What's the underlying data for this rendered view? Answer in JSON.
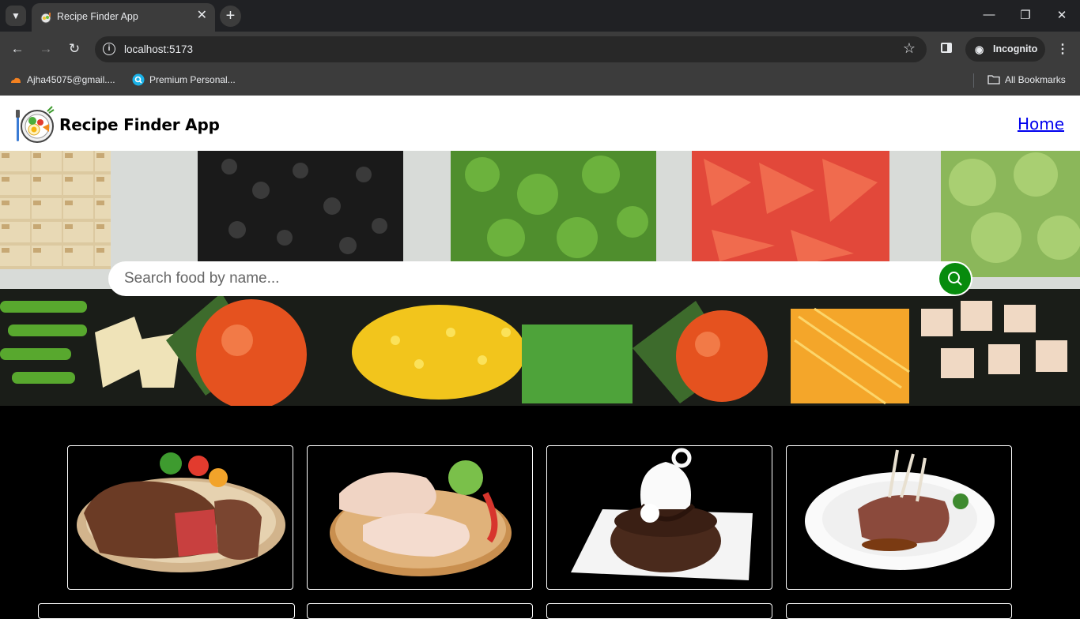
{
  "browser": {
    "tab_title": "Recipe Finder App",
    "url": "localhost:5173",
    "incognito_label": "Incognito",
    "bookmarks": [
      {
        "label": "Ajha45075@gmail...."
      },
      {
        "label": "Premium Personal..."
      }
    ],
    "all_bookmarks_label": "All Bookmarks"
  },
  "header": {
    "title": "Recipe Finder App",
    "nav_home": "Home"
  },
  "search": {
    "placeholder": "Search food by name..."
  },
  "cards": [
    {
      "name": "steak-card",
      "icon": "steak-image"
    },
    {
      "name": "chicken-card",
      "icon": "chicken-image"
    },
    {
      "name": "dessert-card",
      "icon": "chocolate-dessert-image"
    },
    {
      "name": "lamb-card",
      "icon": "lamb-chops-image"
    }
  ],
  "colors": {
    "search_button": "#078b0d",
    "link": "#0000ee",
    "page_background": "#000000"
  }
}
